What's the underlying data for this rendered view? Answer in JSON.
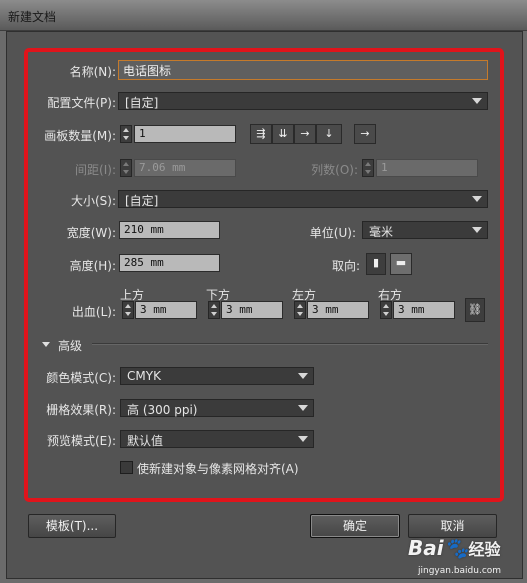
{
  "window": {
    "title": "新建文档"
  },
  "form": {
    "name_label": "名称(N):",
    "name_value": "电话图标",
    "profile_label": "配置文件(P):",
    "profile_value": "[自定]",
    "artboards_label": "画板数量(M):",
    "artboards_value": "1",
    "spacing_label": "间距(I):",
    "spacing_value": "7.06 mm",
    "columns_label": "列数(O):",
    "columns_value": "1",
    "size_label": "大小(S):",
    "size_value": "[自定]",
    "width_label": "宽度(W):",
    "width_value": "210 mm",
    "units_label": "单位(U):",
    "units_value": "毫米",
    "height_label": "高度(H):",
    "height_value": "285 mm",
    "orientation_label": "取向:",
    "bleed_label": "出血(L):",
    "bleed_top_label": "上方",
    "bleed_bottom_label": "下方",
    "bleed_left_label": "左方",
    "bleed_right_label": "右方",
    "bleed_top": "3 mm",
    "bleed_bottom": "3 mm",
    "bleed_left": "3 mm",
    "bleed_right": "3 mm"
  },
  "advanced": {
    "header": "高级",
    "color_mode_label": "颜色模式(C):",
    "color_mode_value": "CMYK",
    "raster_label": "栅格效果(R):",
    "raster_value": "高 (300 ppi)",
    "preview_label": "预览模式(E):",
    "preview_value": "默认值",
    "align_checkbox_label": "使新建对象与像素网格对齐(A)",
    "align_checked": false
  },
  "footer": {
    "templates_button": "模板(T)...",
    "ok_button": "确定",
    "cancel_button": "取消"
  },
  "watermark": {
    "brand": "Bai",
    "brand_suffix": "经验",
    "url": "jingyan.baidu.com"
  },
  "colors": {
    "highlight_box": "#e0141b",
    "focus_border": "#c57a2b"
  }
}
